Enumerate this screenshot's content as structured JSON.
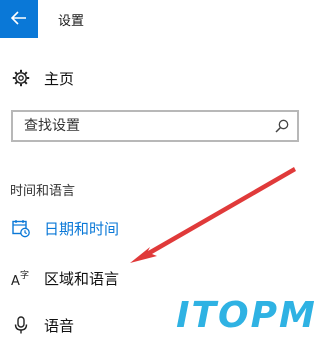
{
  "window": {
    "title": "设置",
    "back_icon": "arrow-left-icon"
  },
  "home": {
    "label": "主页",
    "icon": "gear-icon"
  },
  "search": {
    "placeholder": "查找设置",
    "value": "",
    "icon": "search-icon"
  },
  "section": {
    "title": "时间和语言"
  },
  "nav": {
    "items": [
      {
        "label": "日期和时间",
        "icon": "calendar-clock-icon",
        "active": true
      },
      {
        "label": "区域和语言",
        "icon": "language-icon",
        "active": false
      },
      {
        "label": "语音",
        "icon": "microphone-icon",
        "active": false
      }
    ]
  },
  "watermark": {
    "text": "ITOPM"
  },
  "colors": {
    "accent": "#0a78d7",
    "annotation_arrow": "#e03a3a",
    "watermark": "#2fb2e3"
  }
}
